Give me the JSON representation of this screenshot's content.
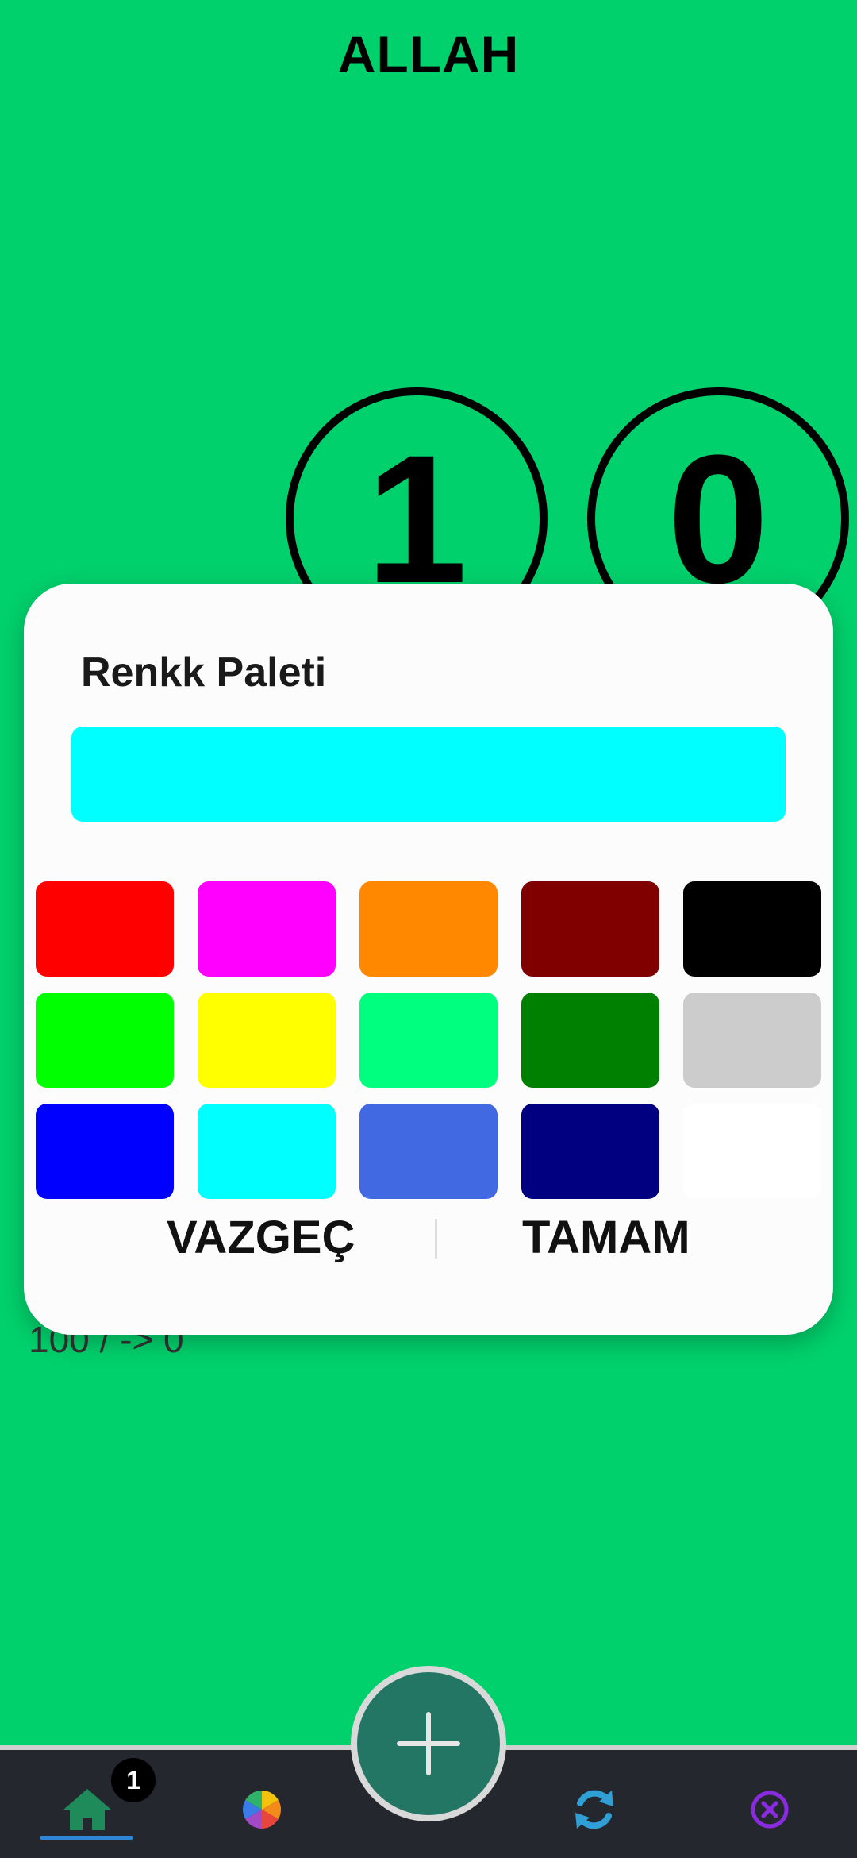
{
  "app": {
    "title": "ALLAH"
  },
  "counter": {
    "digits": [
      "1",
      "0"
    ],
    "range_text": "100 / -> 0"
  },
  "dialog": {
    "title": "Renkk Paleti",
    "selected_color": "#00ffff",
    "swatches": [
      "#ff0000",
      "#ff00ff",
      "#ff8800",
      "#800000",
      "#000000",
      "#00ff00",
      "#ffff00",
      "#00ff7f",
      "#008000",
      "#cccccc",
      "#0000ff",
      "#00ffff",
      "#4169e1",
      "#000080",
      "#ffffff"
    ],
    "cancel_label": "VAZGEÇ",
    "ok_label": "TAMAM"
  },
  "nav": {
    "badge_count": "1",
    "icons": [
      "home-icon",
      "color-wheel-icon",
      "add-icon",
      "refresh-icon",
      "close-circle-icon"
    ],
    "colors": {
      "home": "#1f8a5a",
      "refresh": "#2f9fd6",
      "close": "#8a2be2"
    }
  },
  "theme": {
    "background": "#00d16c",
    "fab": "#237564",
    "bar": "#25272e"
  }
}
